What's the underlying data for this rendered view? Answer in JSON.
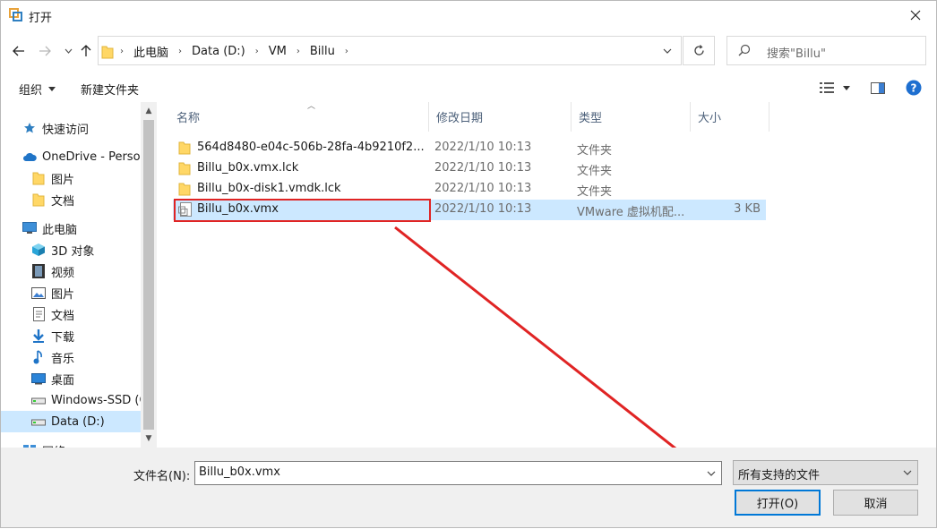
{
  "window": {
    "title": "打开",
    "close_glyph": "✕"
  },
  "address": {
    "crumbs": [
      "此电脑",
      "Data (D:)",
      "VM",
      "Billu"
    ]
  },
  "search": {
    "placeholder": "搜索\"Billu\""
  },
  "toolbar": {
    "organize": "组织",
    "new_folder": "新建文件夹"
  },
  "sidebar": {
    "items": [
      {
        "label": "快速访问",
        "icon": "star-icon",
        "indent": 0
      },
      {
        "label": "OneDrive - Persor",
        "icon": "cloud-icon",
        "indent": 0
      },
      {
        "label": "图片",
        "icon": "folder-icon",
        "indent": 1
      },
      {
        "label": "文档",
        "icon": "folder-icon",
        "indent": 1
      },
      {
        "label": "此电脑",
        "icon": "computer-icon",
        "indent": 0
      },
      {
        "label": "3D 对象",
        "icon": "cube-icon",
        "indent": 1
      },
      {
        "label": "视频",
        "icon": "film-icon",
        "indent": 1
      },
      {
        "label": "图片",
        "icon": "picture-icon",
        "indent": 1
      },
      {
        "label": "文档",
        "icon": "document-icon",
        "indent": 1
      },
      {
        "label": "下载",
        "icon": "download-icon",
        "indent": 1
      },
      {
        "label": "音乐",
        "icon": "music-icon",
        "indent": 1
      },
      {
        "label": "桌面",
        "icon": "desktop-icon",
        "indent": 1
      },
      {
        "label": "Windows-SSD (C",
        "icon": "drive-icon",
        "indent": 1
      },
      {
        "label": "Data (D:)",
        "icon": "drive-icon",
        "indent": 1,
        "selected": true
      },
      {
        "label": "网络",
        "icon": "network-icon",
        "indent": 0
      }
    ]
  },
  "columns": {
    "name": "名称",
    "modified": "修改日期",
    "type": "类型",
    "size": "大小"
  },
  "files": [
    {
      "name": "564d8480-e04c-506b-28fa-4b9210f2...",
      "modified": "2022/1/10 10:13",
      "type": "文件夹",
      "size": "",
      "icon": "folder-icon"
    },
    {
      "name": "Billu_b0x.vmx.lck",
      "modified": "2022/1/10 10:13",
      "type": "文件夹",
      "size": "",
      "icon": "folder-icon"
    },
    {
      "name": "Billu_b0x-disk1.vmdk.lck",
      "modified": "2022/1/10 10:13",
      "type": "文件夹",
      "size": "",
      "icon": "folder-icon"
    },
    {
      "name": "Billu_b0x.vmx",
      "modified": "2022/1/10 10:13",
      "type": "VMware 虚拟机配...",
      "size": "3 KB",
      "icon": "vmx-file-icon",
      "selected": true
    }
  ],
  "bottom": {
    "filename_label": "文件名(N):",
    "filename_value": "Billu_b0x.vmx",
    "filetype_value": "所有支持的文件",
    "open_label": "打开(O)",
    "cancel_label": "取消"
  },
  "colors": {
    "selection": "#cce8ff",
    "annotation": "#e02424",
    "accent": "#0078d7",
    "help": "#1e6fd0"
  }
}
